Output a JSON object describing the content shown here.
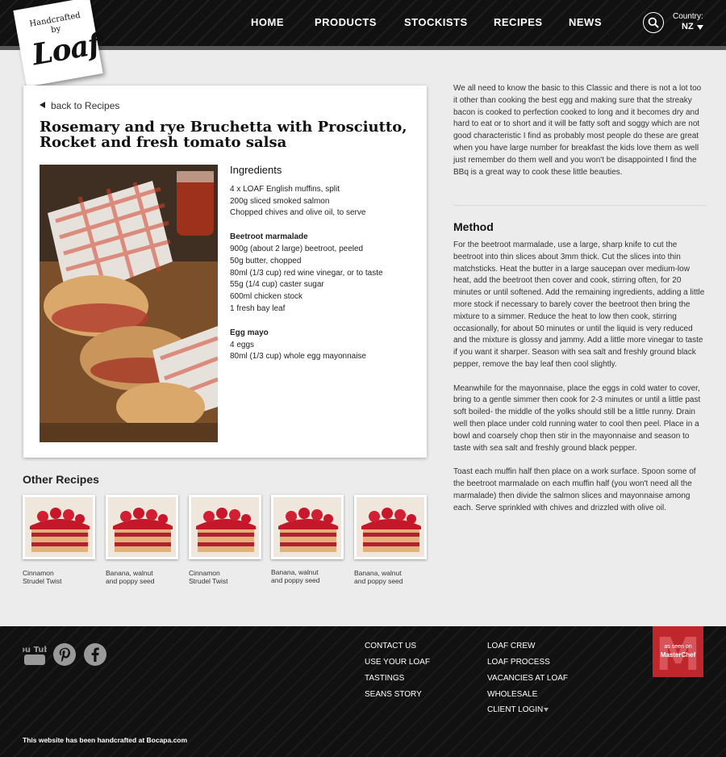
{
  "header": {
    "logo": {
      "line1": "Handcrafted",
      "line2": "by",
      "wordmark": "Loaf"
    },
    "nav": [
      "HOME",
      "PRODUCTS",
      "STOCKISTS",
      "RECIPES",
      "NEWS"
    ],
    "country_label": "Country:",
    "country_value": "NZ"
  },
  "recipe": {
    "back_label": "back to Recipes",
    "title": "Rosemary and rye Bruchetta with Prosciutto, Rocket and fresh tomato salsa",
    "ingredients_heading": "Ingredients",
    "ingredients_main": [
      "4 x LOAF English muffins, split",
      "200g sliced smoked salmon",
      "Chopped chives and olive oil, to serve"
    ],
    "marmalade_heading": "Beetroot marmalade",
    "marmalade": [
      "900g (about 2 large) beetroot, peeled",
      "50g butter, chopped",
      "80ml (1/3 cup) red wine vinegar, or to taste",
      "55g (1/4 cup) caster sugar",
      "600ml chicken stock",
      "1 fresh bay leaf"
    ],
    "mayo_heading": "Egg mayo",
    "mayo": [
      "4 eggs",
      "80ml (1/3 cup) whole egg mayonnaise"
    ]
  },
  "other_recipes": {
    "heading": "Other Recipes",
    "items": [
      {
        "caption": "Cinnamon Strudel Twist"
      },
      {
        "caption": "Banana, walnut and poppy seed"
      },
      {
        "caption": "Cinnamon Strudel Twist"
      },
      {
        "caption": "Banana, walnut and poppy seed"
      },
      {
        "caption": "Banana, walnut and poppy seed"
      }
    ]
  },
  "intro": "We all need to know the basic to this Classic and there is not a lot too it other than cooking the best egg and making sure that the streaky bacon is cooked to perfection cooked to long and it becomes dry and hard to eat or to short and it will be fatty soft and soggy which are not good characteristic I find as probably most people do these are great when you have large number for breakfast the kids love them as well just remember do them well and you won't be disappointed I find the BBq is a great way to cook these little beauties.",
  "method": {
    "heading": "Method",
    "paragraphs": [
      "For the beetroot marmalade, use a large, sharp knife to cut the beetroot into thin slices about 3mm thick. Cut the slices into thin matchsticks. Heat the butter in a large saucepan over medium-low heat, add the beetroot then cover and cook, stirring often, for 20 minutes or until softened. Add the remaining ingredients, adding a little more stock if necessary to barely cover the beetroot then bring the mixture to a simmer. Reduce the heat to low then cook, stirring occasionally, for about 50 minutes or until the liquid is very reduced and the mixture is glossy and jammy. Add a little more vinegar to taste if you want it sharper. Season with sea salt and freshly ground black pepper, remove the bay leaf then cool slightly.",
      "Meanwhile for the mayonnaise, place the eggs in cold water to cover, bring to a gentle simmer then cook for 2-3 minutes or until a little past soft boiled- the middle of the yolks should still be a little runny. Drain well then place under cold running water to cool then peel. Place in a bowl and coarsely chop then stir in the mayonnaise and season to taste with sea salt and freshly ground black pepper.",
      "Toast each muffin half then place on a work surface. Spoon some of the beetroot marmalade on each muffin half (you won't need all the marmalade) then divide the salmon slices and mayonnaise among each. Serve sprinkled with chives and drizzled with olive oil."
    ]
  },
  "footer": {
    "social_icons": [
      "youtube-icon",
      "pinterest-icon",
      "facebook-icon"
    ],
    "youtube_label": "You Tube",
    "links_col1": [
      "CONTACT US",
      "USE YOUR LOAF",
      "TASTINGS",
      "SEANS STORY"
    ],
    "links_col2": [
      "LOAF CREW",
      "LOAF PROCESS",
      "VACANCIES AT LOAF",
      "WHOLESALE",
      "CLIENT LOGIN"
    ],
    "masterchef": {
      "seen": "as seen on",
      "name": "MasterChef",
      "letter": "M"
    },
    "credit": "This website has been handcrafted at Bocapa.com"
  }
}
